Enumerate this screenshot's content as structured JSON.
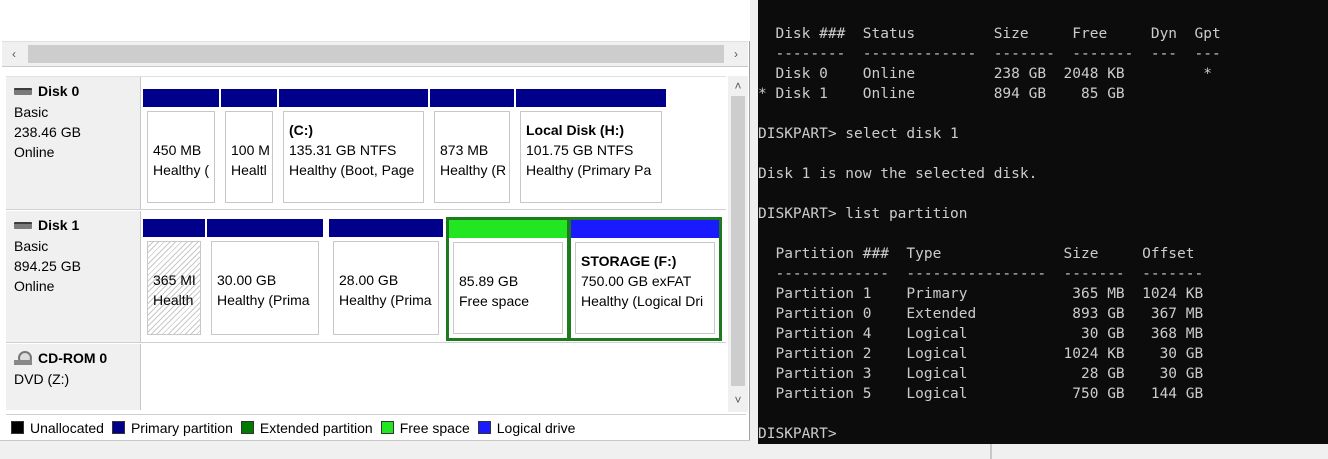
{
  "disks": [
    {
      "name": "Disk 0",
      "type": "Basic",
      "size": "238.46 GB",
      "status": "Online",
      "partitions": [
        {
          "title": "",
          "l1": "450 MB",
          "l2": "Healthy (",
          "color": "#00008b"
        },
        {
          "title": "",
          "l1": "100 M",
          "l2": "Healtl",
          "color": "#00008b"
        },
        {
          "title": "(C:)",
          "l1": "135.31 GB NTFS",
          "l2": "Healthy (Boot, Page",
          "color": "#00008b"
        },
        {
          "title": "",
          "l1": "873 MB",
          "l2": "Healthy (R",
          "color": "#00008b"
        },
        {
          "title": "Local Disk  (H:)",
          "l1": "101.75 GB NTFS",
          "l2": "Healthy (Primary Pa",
          "color": "#00008b"
        }
      ]
    },
    {
      "name": "Disk 1",
      "type": "Basic",
      "size": "894.25 GB",
      "status": "Online",
      "partitions": [
        {
          "title": "",
          "l1": "365 MI",
          "l2": "Health",
          "color": "#00008b"
        },
        {
          "title": "",
          "l1": "30.00 GB",
          "l2": "Healthy (Prima",
          "color": "#00008b"
        },
        {
          "title": "",
          "l1": "28.00 GB",
          "l2": "Healthy (Prima",
          "color": "#00008b"
        },
        {
          "title": "",
          "l1": "85.89 GB",
          "l2": "Free space",
          "color": "#22e622"
        },
        {
          "title": "STORAGE  (F:)",
          "l1": "750.00 GB exFAT",
          "l2": "Healthy (Logical Dri",
          "color": "#1a1aff"
        }
      ]
    }
  ],
  "cdrom": {
    "name": "CD-ROM 0",
    "type": "DVD (Z:)"
  },
  "legend": [
    {
      "label": "Unallocated",
      "color": "#000000"
    },
    {
      "label": "Primary partition",
      "color": "#00008b"
    },
    {
      "label": "Extended partition",
      "color": "#007a00"
    },
    {
      "label": "Free space",
      "color": "#22e622"
    },
    {
      "label": "Logical drive",
      "color": "#1a1aff"
    }
  ],
  "console": {
    "disk_table": {
      "headers": [
        "Disk ###",
        "Status",
        "Size",
        "Free",
        "Dyn",
        "Gpt"
      ],
      "rows": [
        {
          "marker": " ",
          "disk": "Disk 0",
          "status": "Online",
          "size": "238 GB",
          "free": "2048 KB",
          "dyn": "",
          "gpt": "*"
        },
        {
          "marker": "*",
          "disk": "Disk 1",
          "status": "Online",
          "size": "894 GB",
          "free": "85 GB",
          "dyn": "",
          "gpt": ""
        }
      ]
    },
    "cmd1": "DISKPART> select disk 1",
    "msg1": "Disk 1 is now the selected disk.",
    "cmd2": "DISKPART> list partition",
    "partition_table": {
      "headers": [
        "Partition ###",
        "Type",
        "Size",
        "Offset"
      ],
      "rows": [
        {
          "part": "Partition 1",
          "type": "Primary",
          "size": "365 MB",
          "offset": "1024 KB"
        },
        {
          "part": "Partition 0",
          "type": "Extended",
          "size": "893 GB",
          "offset": "367 MB"
        },
        {
          "part": "Partition 4",
          "type": "Logical",
          "size": "30 GB",
          "offset": "368 MB"
        },
        {
          "part": "Partition 2",
          "type": "Logical",
          "size": "1024 KB",
          "offset": "30 GB"
        },
        {
          "part": "Partition 3",
          "type": "Logical",
          "size": "28 GB",
          "offset": "30 GB"
        },
        {
          "part": "Partition 5",
          "type": "Logical",
          "size": "750 GB",
          "offset": "144 GB"
        }
      ]
    },
    "prompt": "DISKPART>"
  }
}
